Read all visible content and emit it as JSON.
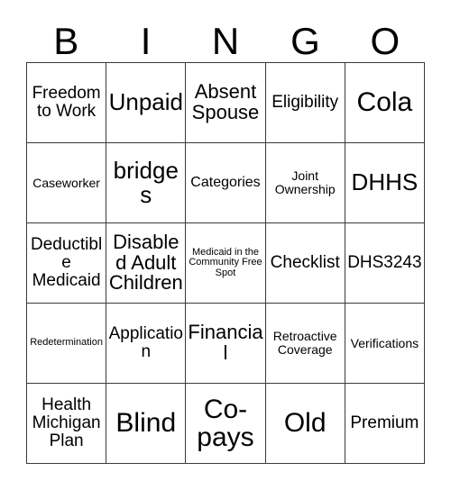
{
  "card": {
    "header_letters": [
      "B",
      "I",
      "N",
      "G",
      "O"
    ],
    "columns": 5,
    "rows": 5,
    "border_color": "#3a3a3a",
    "background_color": "#ffffff",
    "text_color": "#000000",
    "free_space_index": 12,
    "cells": [
      {
        "text": "Freedom to Work",
        "size": "md"
      },
      {
        "text": "Unpaid",
        "size": "xl"
      },
      {
        "text": "Absent Spouse",
        "size": "lg"
      },
      {
        "text": "Eligibility",
        "size": "md"
      },
      {
        "text": "Cola",
        "size": "xxl"
      },
      {
        "text": "Caseworker",
        "size": "xs"
      },
      {
        "text": "bridges",
        "size": "xl"
      },
      {
        "text": "Categories",
        "size": "sm"
      },
      {
        "text": "Joint Ownership",
        "size": "xs"
      },
      {
        "text": "DHHS",
        "size": "xl"
      },
      {
        "text": "Deductible Medicaid",
        "size": "md"
      },
      {
        "text": "Disabled Adult Children",
        "size": "lg"
      },
      {
        "text": "Medicaid in the Community Free Spot",
        "size": "xxs"
      },
      {
        "text": "Checklist",
        "size": "md"
      },
      {
        "text": "DHS3243",
        "size": "md"
      },
      {
        "text": "Redetermination",
        "size": "xxs"
      },
      {
        "text": "Application",
        "size": "md"
      },
      {
        "text": "Financial",
        "size": "lg"
      },
      {
        "text": "Retroactive Coverage",
        "size": "xs"
      },
      {
        "text": "Verifications",
        "size": "xs"
      },
      {
        "text": "Health Michigan Plan",
        "size": "md"
      },
      {
        "text": "Blind",
        "size": "xxl"
      },
      {
        "text": "Co-pays",
        "size": "xxl"
      },
      {
        "text": "Old",
        "size": "xxl"
      },
      {
        "text": "Premium",
        "size": "md"
      }
    ]
  }
}
